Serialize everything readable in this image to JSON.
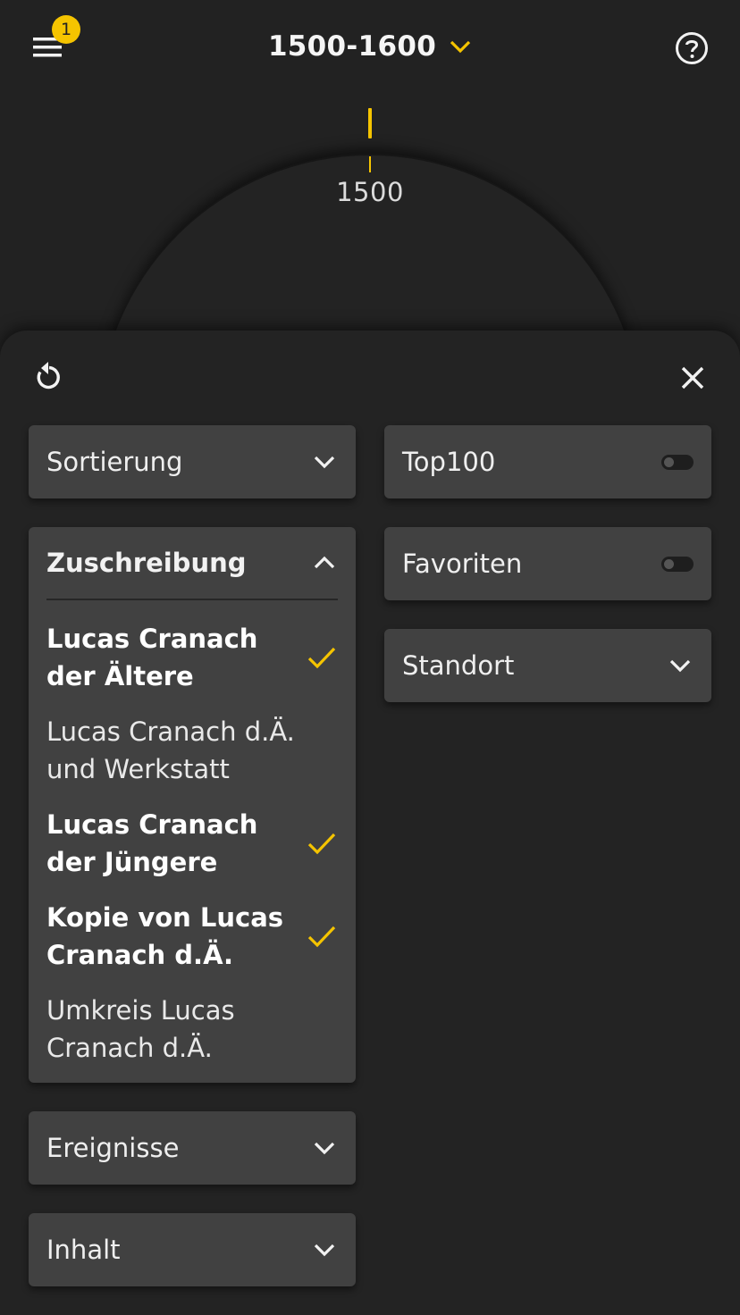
{
  "header": {
    "menu_badge": "1",
    "period_label": "1500-1600"
  },
  "dial": {
    "year_label": "1500"
  },
  "filters": {
    "left": {
      "sortierung": {
        "label": "Sortierung"
      },
      "zuschreibung": {
        "label": "Zuschreibung",
        "options": [
          {
            "label": "Lucas Cranach der Ältere",
            "selected": true
          },
          {
            "label": "Lucas Cranach d.Ä. und Werkstatt",
            "selected": false
          },
          {
            "label": "Lucas Cranach der Jüngere",
            "selected": true
          },
          {
            "label": "Kopie von Lucas Cranach d.Ä.",
            "selected": true
          },
          {
            "label": "Umkreis Lucas Cranach d.Ä.",
            "selected": false
          }
        ]
      },
      "ereignisse": {
        "label": "Ereignisse"
      },
      "inhalt": {
        "label": "Inhalt"
      }
    },
    "right": {
      "top100": {
        "label": "Top100",
        "enabled": false
      },
      "favoriten": {
        "label": "Favoriten",
        "enabled": false
      },
      "standort": {
        "label": "Standort"
      }
    }
  },
  "colors": {
    "accent": "#f5c400",
    "background": "#222222",
    "card": "#414141"
  }
}
